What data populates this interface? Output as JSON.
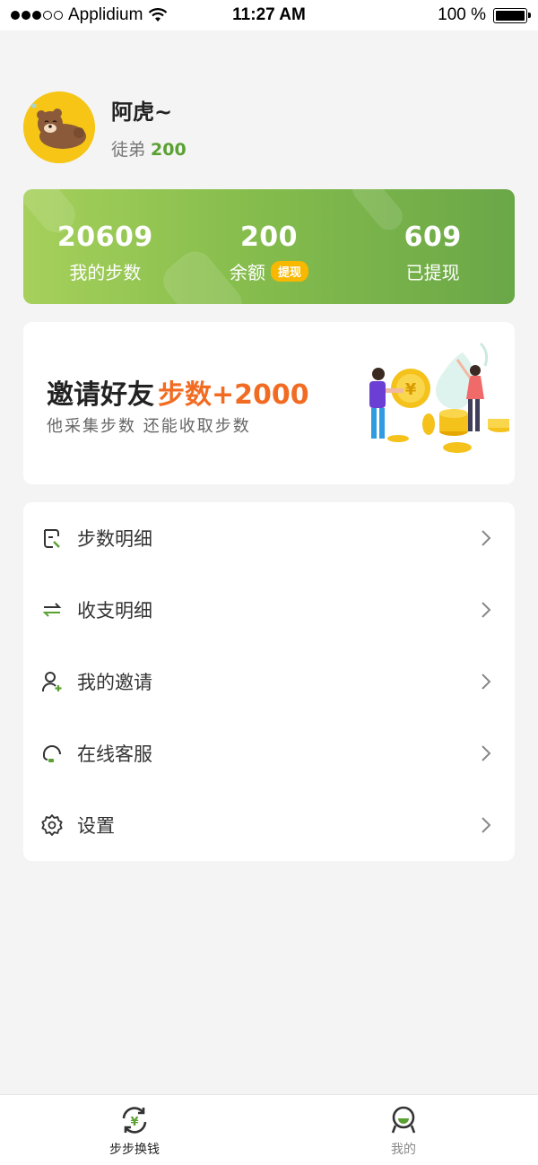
{
  "status_bar": {
    "carrier": "Applidium",
    "time": "11:27 AM",
    "battery": "100 %"
  },
  "profile": {
    "name": "阿虎~",
    "apprentice_label": "徒弟",
    "apprentice_count": "200"
  },
  "stats": {
    "steps_value": "20609",
    "steps_label": "我的步数",
    "balance_value": "200",
    "balance_label": "余额",
    "withdraw_badge": "提现",
    "withdrawn_value": "609",
    "withdrawn_label": "已提现"
  },
  "invite": {
    "title": "邀请好友",
    "highlight": "步数+2000",
    "subtitle": "他采集步数 还能收取步数"
  },
  "menu": {
    "items": [
      {
        "label": "步数明细",
        "icon": "step-detail-icon"
      },
      {
        "label": "收支明细",
        "icon": "transfer-icon"
      },
      {
        "label": "我的邀请",
        "icon": "add-user-icon"
      },
      {
        "label": "在线客服",
        "icon": "headset-icon"
      },
      {
        "label": "设置",
        "icon": "gear-icon"
      }
    ]
  },
  "tabs": [
    {
      "label": "步步换钱",
      "icon": "exchange-yen-icon",
      "active": true
    },
    {
      "label": "我的",
      "icon": "profile-face-icon",
      "active": false
    }
  ],
  "colors": {
    "accent_green": "#5aa032",
    "card_gradient_start": "#a6d05b",
    "card_gradient_end": "#6aa747",
    "highlight_orange": "#f26b22",
    "badge_yellow": "#f8b800"
  }
}
